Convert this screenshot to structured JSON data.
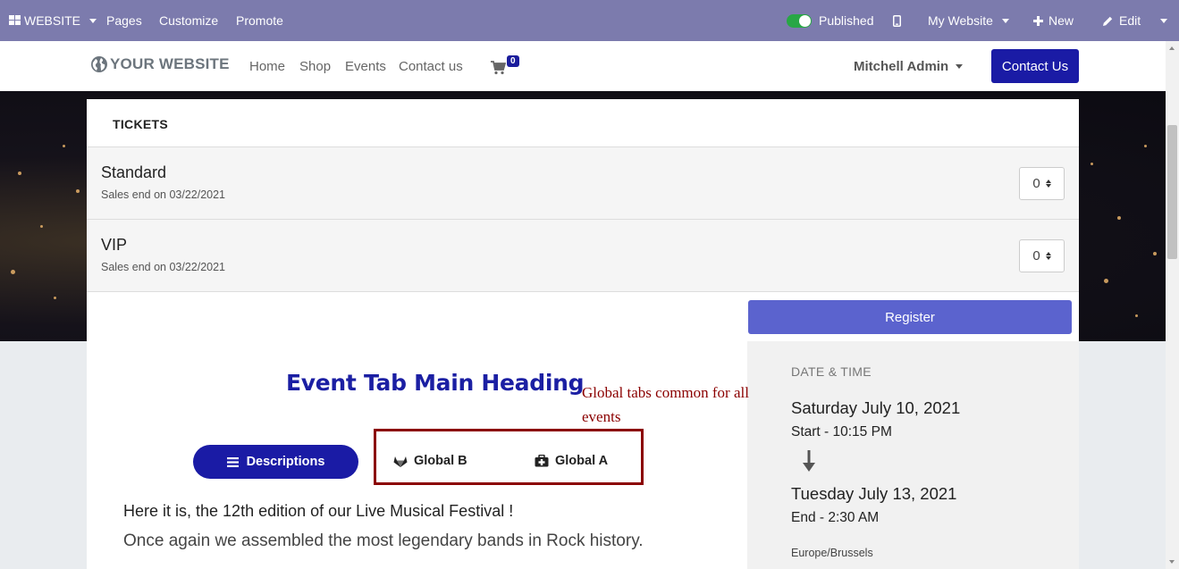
{
  "topbar": {
    "website_label": "WEBSITE",
    "pages": "Pages",
    "customize": "Customize",
    "promote": "Promote",
    "published": "Published",
    "my_website": "My Website",
    "new": "New",
    "edit": "Edit"
  },
  "header": {
    "logo_text": "YOUR WEBSITE",
    "nav": [
      "Home",
      "Shop",
      "Events",
      "Contact us"
    ],
    "cart_count": "0",
    "user": "Mitchell Admin",
    "contact_button": "Contact Us"
  },
  "tickets": {
    "heading": "TICKETS",
    "items": [
      {
        "name": "Standard",
        "sales_end": "Sales end on 03/22/2021",
        "qty": "0"
      },
      {
        "name": "VIP",
        "sales_end": "Sales end on 03/22/2021",
        "qty": "0"
      }
    ]
  },
  "register": {
    "label": "Register"
  },
  "datetime": {
    "label": "DATE & TIME",
    "start_date": "Saturday July 10, 2021",
    "start_time": "Start - 10:15 PM",
    "end_date": "Tuesday July 13, 2021",
    "end_time": "End - 2:30 AM",
    "timezone": "Europe/Brussels"
  },
  "event": {
    "main_heading": "Event Tab Main Heading",
    "annotation": "Global tabs common for all events",
    "tabs": [
      {
        "label": "Descriptions",
        "icon": "bars-icon",
        "active": true
      },
      {
        "label": "Global B",
        "icon": "gitlab-icon",
        "active": false
      },
      {
        "label": "Global A",
        "icon": "medkit-icon",
        "active": false
      }
    ],
    "body_line_1": "Here it is, the 12th edition of our Live Musical Festival !",
    "body_line_2": "Once again we assembled the most legendary bands in Rock history."
  },
  "colors": {
    "topbar": "#7c7bad",
    "primary": "#1a1ba5",
    "register": "#5b63ce",
    "annotation": "#8b0000",
    "toggle_on": "#28a745"
  }
}
